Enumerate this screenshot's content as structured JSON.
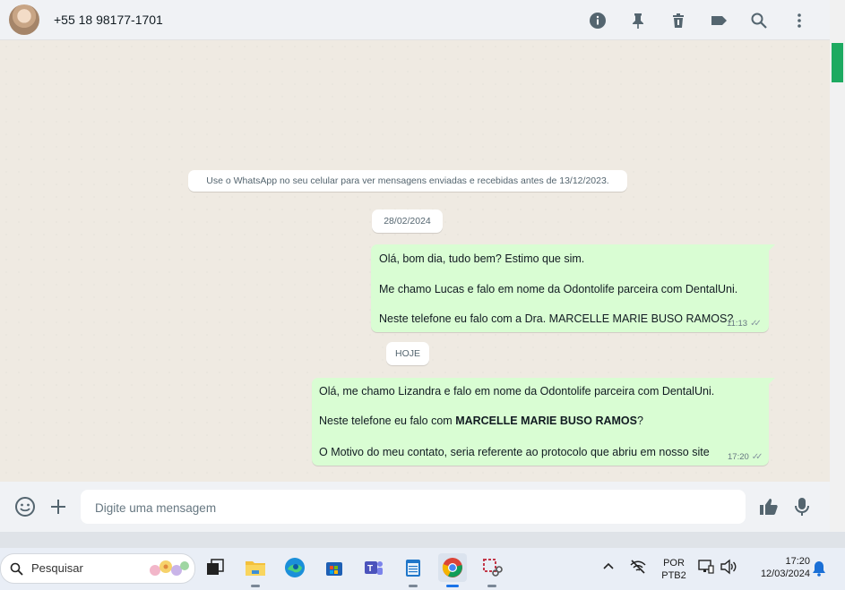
{
  "header": {
    "contact_name": "+55 18 98177-1701",
    "icons": [
      "info-icon",
      "pin-icon",
      "delete-icon",
      "label-icon",
      "search-icon",
      "menu-icon"
    ]
  },
  "chat": {
    "system_note": "Use o WhatsApp no seu celular para ver mensagens enviadas e recebidas antes de 13/12/2023.",
    "date_chip_1": "28/02/2024",
    "msg1": {
      "line1": "Olá, bom dia, tudo bem? Estimo que sim.",
      "line2": "Me chamo Lucas e falo em nome da Odontolife parceira com DentalUni.",
      "line3": "Neste telefone eu falo com a Dra. MARCELLE MARIE BUSO RAMOS?",
      "time": "11:13",
      "ticks": "✓✓"
    },
    "date_chip_2": "HOJE",
    "msg2": {
      "line1": "Olá, me chamo Lizandra e falo em nome da Odontolife parceira com DentalUni.",
      "line2_prefix": "Neste telefone eu falo com ",
      "line2_bold": "MARCELLE MARIE BUSO RAMOS",
      "line2_suffix": "?",
      "line3": "O Motivo do meu contato, seria referente ao protocolo que abriu em nosso site",
      "time": "17:20",
      "ticks": "✓✓"
    }
  },
  "composer": {
    "placeholder": "Digite uma mensagem"
  },
  "taskbar": {
    "search_label": "Pesquisar",
    "language": "POR",
    "keyboard": "PTB2",
    "time": "17:20",
    "date": "12/03/2024"
  },
  "colors": {
    "outgoing_bubble": "#d9fdd3",
    "chat_background": "#efeae2",
    "accent_green": "#1daa61"
  }
}
